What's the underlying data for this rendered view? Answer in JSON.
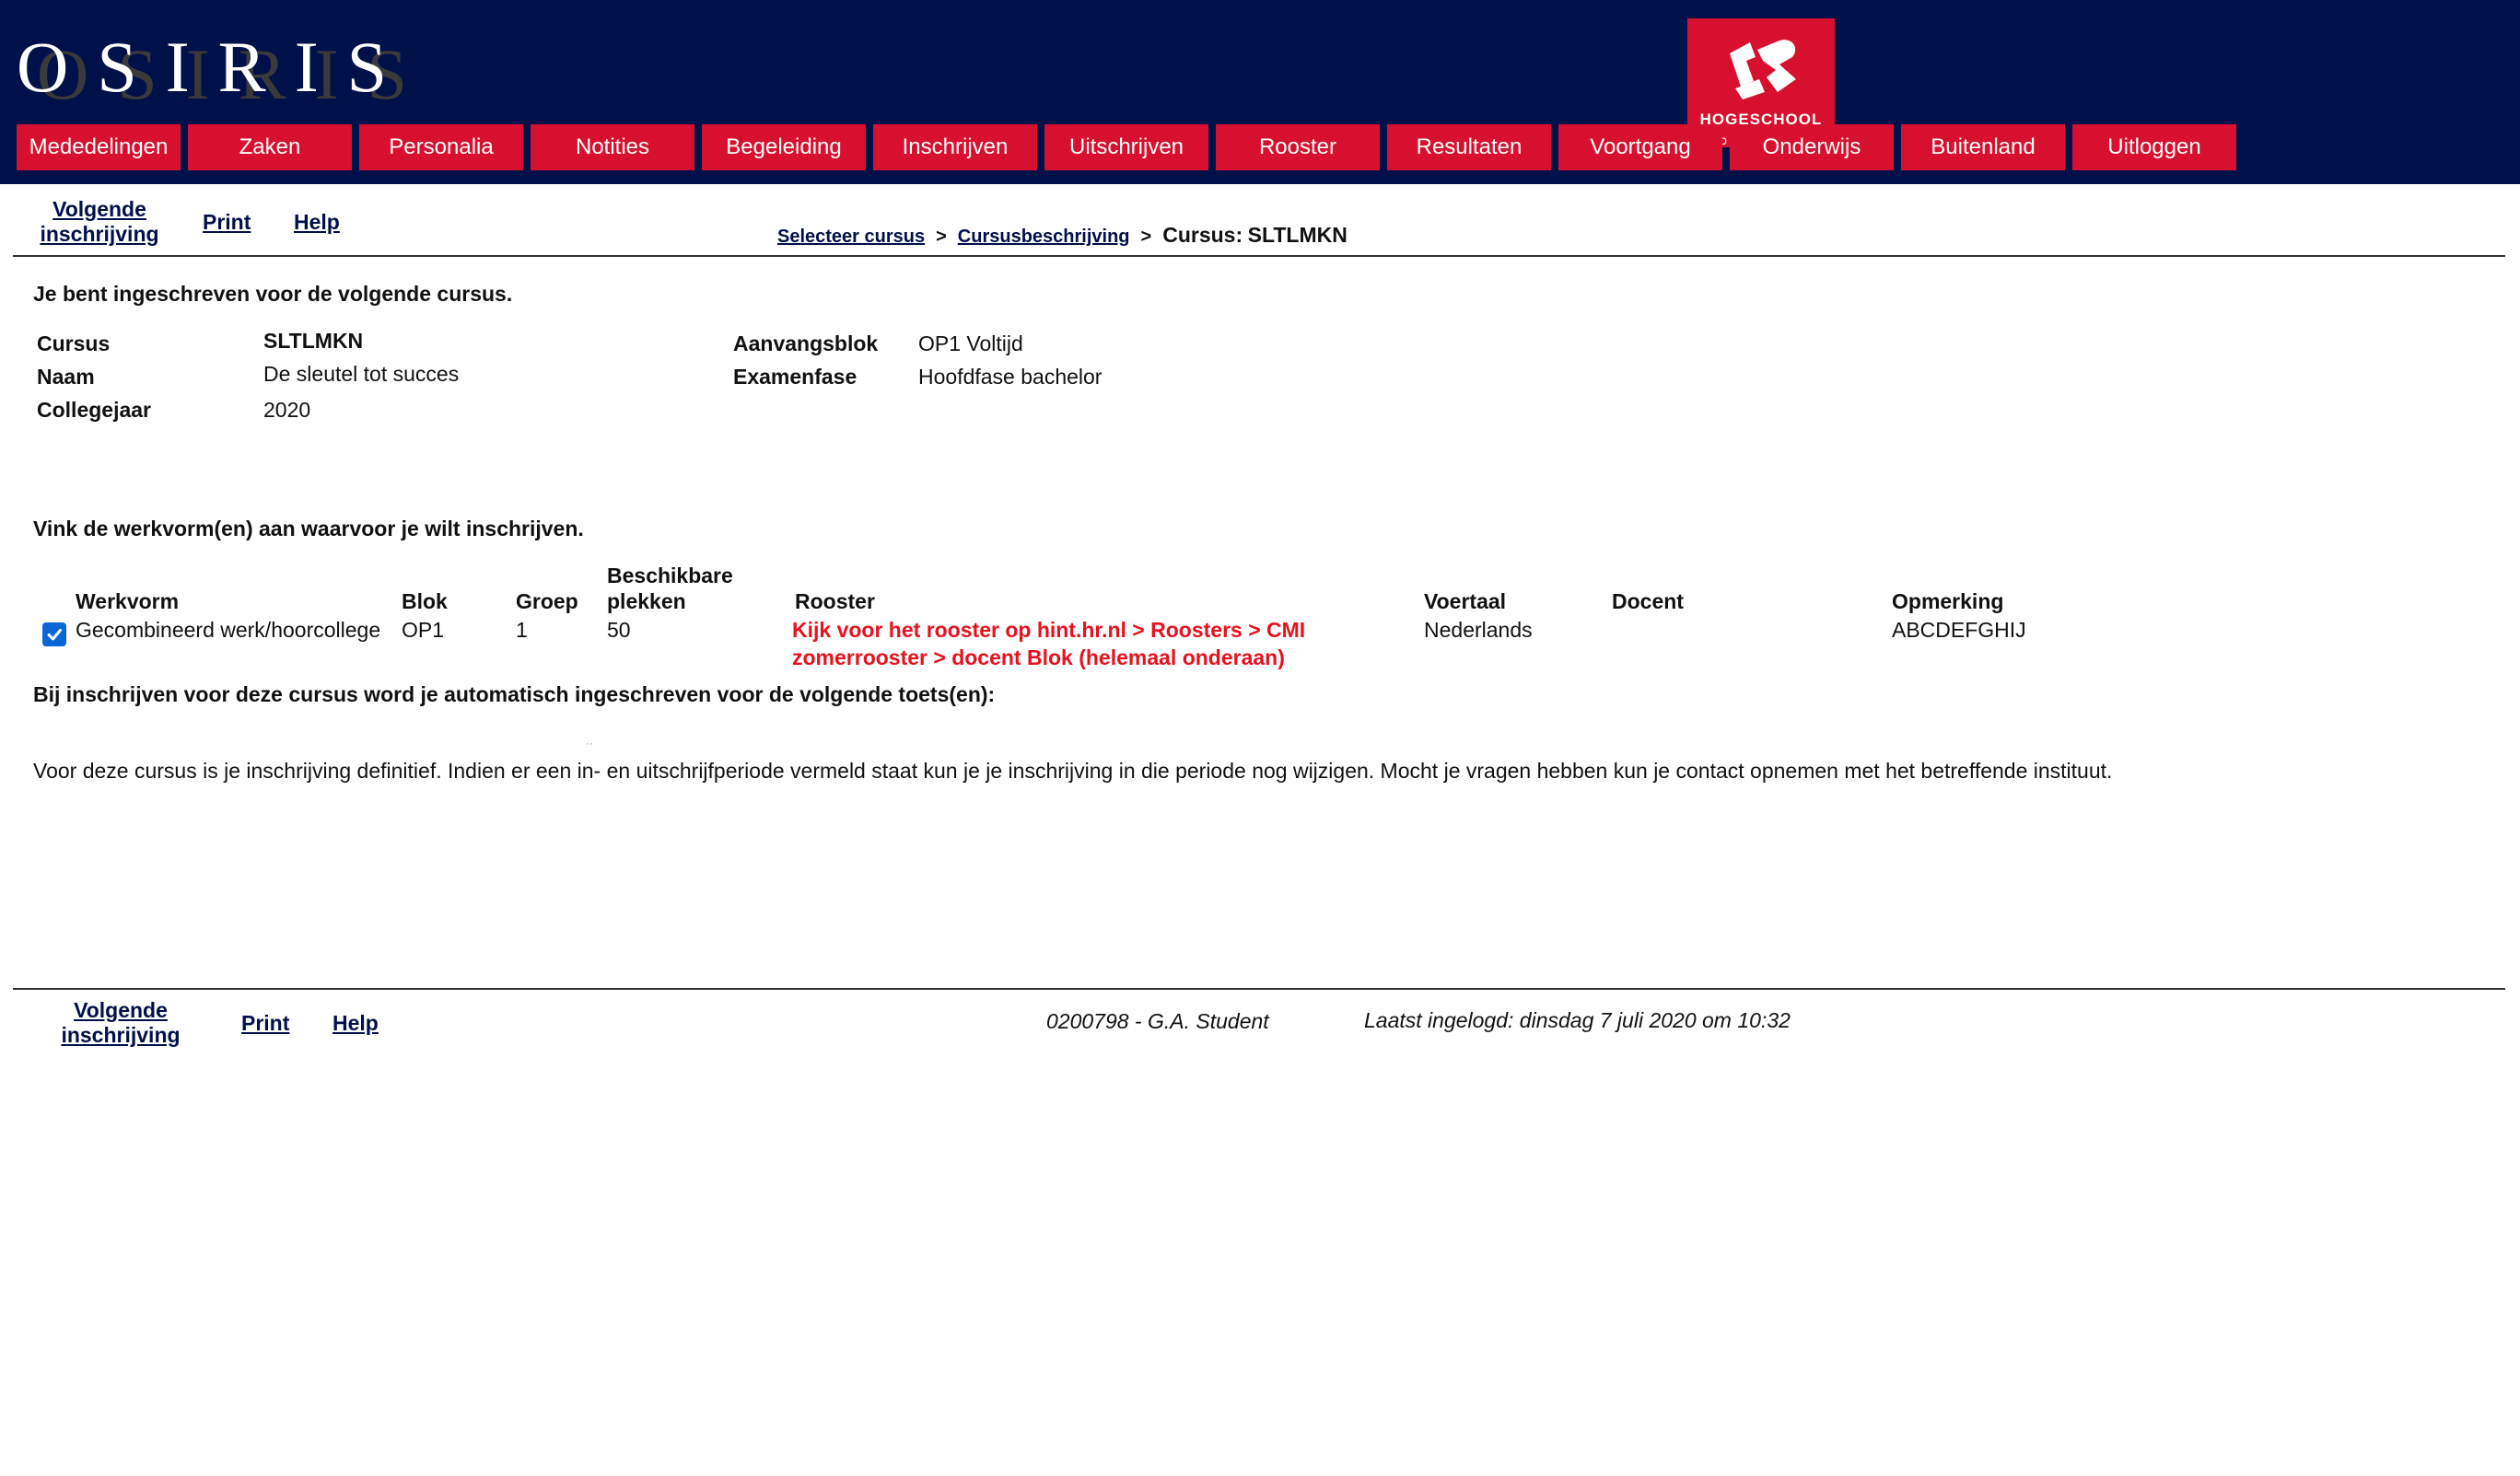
{
  "header": {
    "brand": "OSIRIS",
    "logo_text": "HOGESCHOOL",
    "logo_color": "#d8102f",
    "bg_color": "#001049",
    "nav": [
      {
        "label": "Mededelingen"
      },
      {
        "label": "Zaken"
      },
      {
        "label": "Personalia"
      },
      {
        "label": "Notities"
      },
      {
        "label": "Begeleiding"
      },
      {
        "label": "Inschrijven"
      },
      {
        "label": "Uitschrijven"
      },
      {
        "label": "Rooster"
      },
      {
        "label": "Resultaten"
      },
      {
        "label": "Voortgang"
      },
      {
        "label": "Onderwijs"
      },
      {
        "label": "Buitenland"
      },
      {
        "label": "Uitloggen"
      }
    ]
  },
  "toolbar": {
    "next_line1": "Volgende",
    "next_line2": "inschrijving",
    "print": "Print",
    "help": "Help",
    "breadcrumb": {
      "step1": "Selecteer cursus",
      "step2": "Cursusbeschrijving",
      "current_label": "Cursus:",
      "current_code": "SLTLMKN",
      "separator": ">"
    }
  },
  "course": {
    "intro": "Je bent ingeschreven voor de volgende cursus.",
    "labels": {
      "cursus": "Cursus",
      "naam": "Naam",
      "collegejaar": "Collegejaar",
      "aanvangsblok": "Aanvangsblok",
      "examenfase": "Examenfase"
    },
    "values": {
      "cursus": "SLTLMKN",
      "naam": "De sleutel tot succes",
      "collegejaar": "2020",
      "aanvangsblok": "OP1 Voltijd",
      "examenfase": "Hoofdfase bachelor"
    }
  },
  "werkvorm": {
    "instruction": "Vink de werkvorm(en) aan waarvoor je wilt inschrijven.",
    "headers": {
      "werkvorm": "Werkvorm",
      "blok": "Blok",
      "groep": "Groep",
      "plekken_line1": "Beschikbare",
      "plekken_line2": "plekken",
      "rooster": "Rooster",
      "voertaal": "Voertaal",
      "docent": "Docent",
      "opmerking": "Opmerking"
    },
    "rows": [
      {
        "checked": true,
        "werkvorm": "Gecombineerd werk/hoorcollege",
        "blok": "OP1",
        "groep": "1",
        "plekken": "50",
        "rooster_line1": "Kijk voor het rooster op hint.hr.nl > Roosters > CMI",
        "rooster_line2": "zomerrooster > docent Blok (helemaal onderaan)",
        "voertaal": "Nederlands",
        "docent": "",
        "opmerking": "ABCDEFGHIJ"
      }
    ],
    "toetsen_note": "Bij inschrijven voor deze cursus word je automatisch ingeschreven voor de volgende toets(en):",
    "definitief_note": "Voor deze cursus is je inschrijving definitief. Indien er een in- en uitschrijfperiode vermeld staat kun je je inschrijving in die periode nog wijzigen. Mocht je vragen hebben kun je contact opnemen met het betreffende instituut."
  },
  "footer": {
    "next_line1": "Volgende",
    "next_line2": "inschrijving",
    "print": "Print",
    "help": "Help",
    "user": "0200798 - G.A. Student",
    "last_login": "Laatst ingelogd: dinsdag 7 juli 2020 om 10:32"
  }
}
